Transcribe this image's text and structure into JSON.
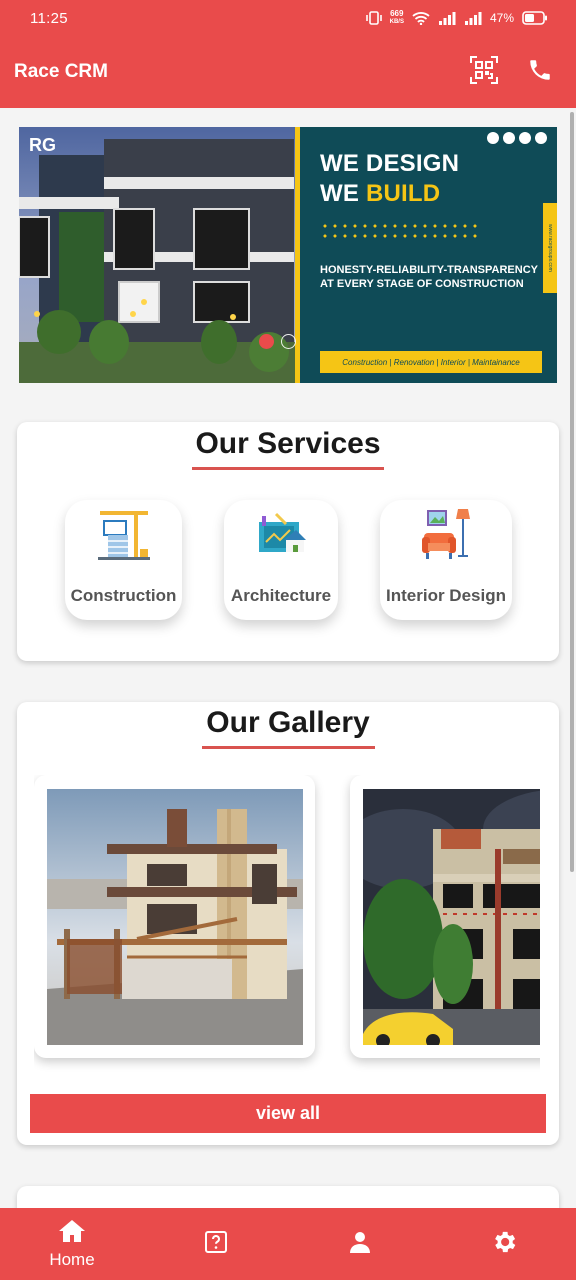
{
  "status_bar": {
    "time": "11:25",
    "net_speed_value": "669",
    "net_speed_unit": "KB/S",
    "battery": "47%"
  },
  "app_bar": {
    "title": "Race CRM",
    "actions": [
      "qr-code-icon",
      "phone-icon"
    ]
  },
  "banner": {
    "headline_line1": "WE DESIGN",
    "headline_line2_prefix": "WE ",
    "headline_line2_highlight": "BUILD",
    "tagline": "HONESTY-RELIABILITY-TRANSPARENCY AT EVERY STAGE OF CONSTRUCTION",
    "services_bar": "Construction | Renovation | Interior | Maintainance",
    "website": "www.racegroups.com",
    "logo_text": "RG",
    "carousel": {
      "count": 3,
      "active_index": 0
    },
    "colors": {
      "panel": "#0f4b57",
      "accent": "#f5c515"
    }
  },
  "services": {
    "title": "Our Services",
    "items": [
      {
        "label": "Construction",
        "icon": "construction-crane-icon"
      },
      {
        "label": "Architecture",
        "icon": "architecture-blueprint-icon"
      },
      {
        "label": "Interior Design",
        "icon": "interior-armchair-icon"
      }
    ]
  },
  "gallery": {
    "title": "Our Gallery",
    "items": [
      {
        "icon": "house-rendering-image"
      },
      {
        "icon": "apartment-night-rendering-image"
      }
    ],
    "view_all_label": "view all"
  },
  "bottom_nav": {
    "items": [
      {
        "label": "Home",
        "icon": "home-icon",
        "active": true
      },
      {
        "label": "",
        "icon": "help-icon",
        "active": false
      },
      {
        "label": "",
        "icon": "profile-icon",
        "active": false
      },
      {
        "label": "",
        "icon": "settings-icon",
        "active": false
      }
    ]
  },
  "colors": {
    "primary": "#e94b4b",
    "underline": "#d9534f",
    "text_dark": "#1a1a1a",
    "text_muted": "#555555"
  }
}
